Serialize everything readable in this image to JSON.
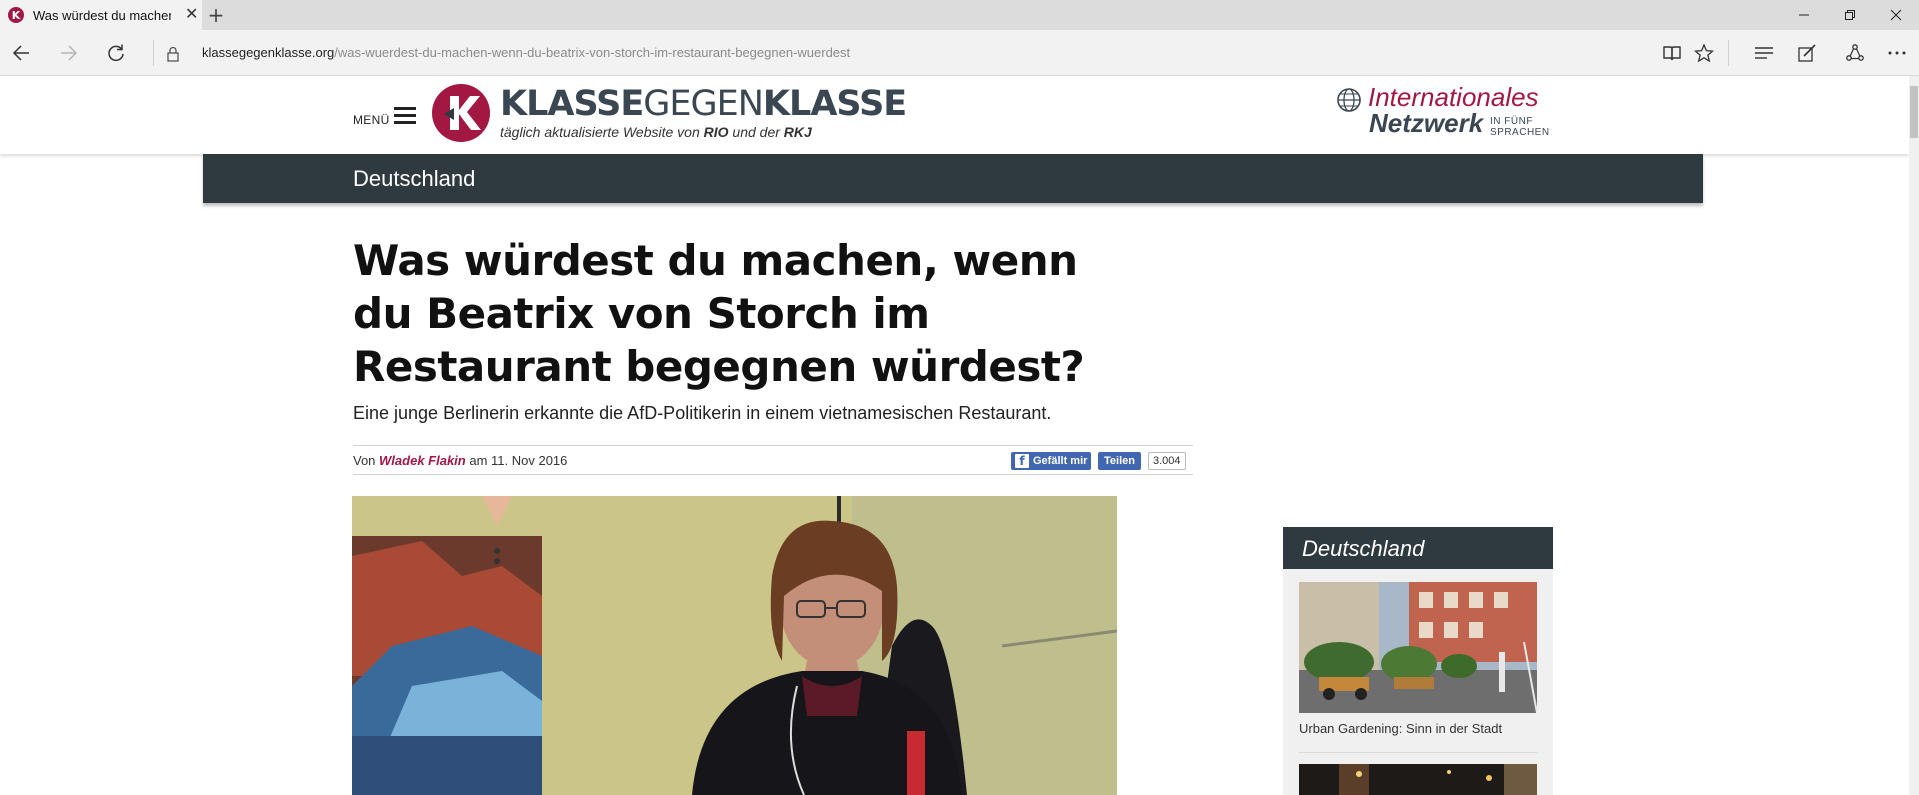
{
  "browser": {
    "tab_title": "Was würdest du machen, wenn du Beatrix von Storch im Restaurant begegnen würdest?",
    "tab_favicon_letter": "K",
    "new_tab_symbol": "+",
    "close_symbol": "✕",
    "url_domain": "klassegegenklasse.org",
    "url_path": "/was-wuerdest-du-machen-wenn-du-beatrix-von-storch-im-restaurant-begegnen-wuerdest",
    "window_buttons": [
      "minimize",
      "restore",
      "close"
    ],
    "toolbar_icons": [
      "reading-view-icon",
      "favorite-star-icon",
      "hub-icon",
      "web-note-icon",
      "share-icon",
      "more-icon"
    ]
  },
  "site": {
    "menu_label": "MENÜ",
    "logo_word_1": "KLASSE",
    "logo_word_2": "GEGEN",
    "logo_word_3": "KLASSE",
    "logo_letter": "K",
    "tagline_prefix": "täglich aktualisierte Website von ",
    "tagline_rio": "RIO",
    "tagline_mid": " und der ",
    "tagline_rkj": "RKJ",
    "network_line1": "Internationales",
    "network_line2": "Netzwerk",
    "network_sub1": "IN FÜNF",
    "network_sub2": "SPRACHEN",
    "brand_color": "#a31842",
    "dark_color": "#2f3a40"
  },
  "section": {
    "label": "Deutschland"
  },
  "article": {
    "headline": "Was würdest du machen, wenn du Beatrix von Storch im Restaurant begegnen würdest?",
    "subtitle": "Eine junge Berlinerin erkannte die AfD-Politikerin in einem vietnamesischen Restaurant.",
    "byline_von": "Von ",
    "author": "Wladek Flakin",
    "byline_date": " am 11. Nov 2016",
    "fb_like_label": "Gefällt mir",
    "fb_share_label": "Teilen",
    "fb_count": "3.004"
  },
  "sidebar": {
    "title": "Deutschland",
    "items": [
      {
        "caption": "Urban Gardening: Sinn in der Stadt"
      }
    ]
  }
}
